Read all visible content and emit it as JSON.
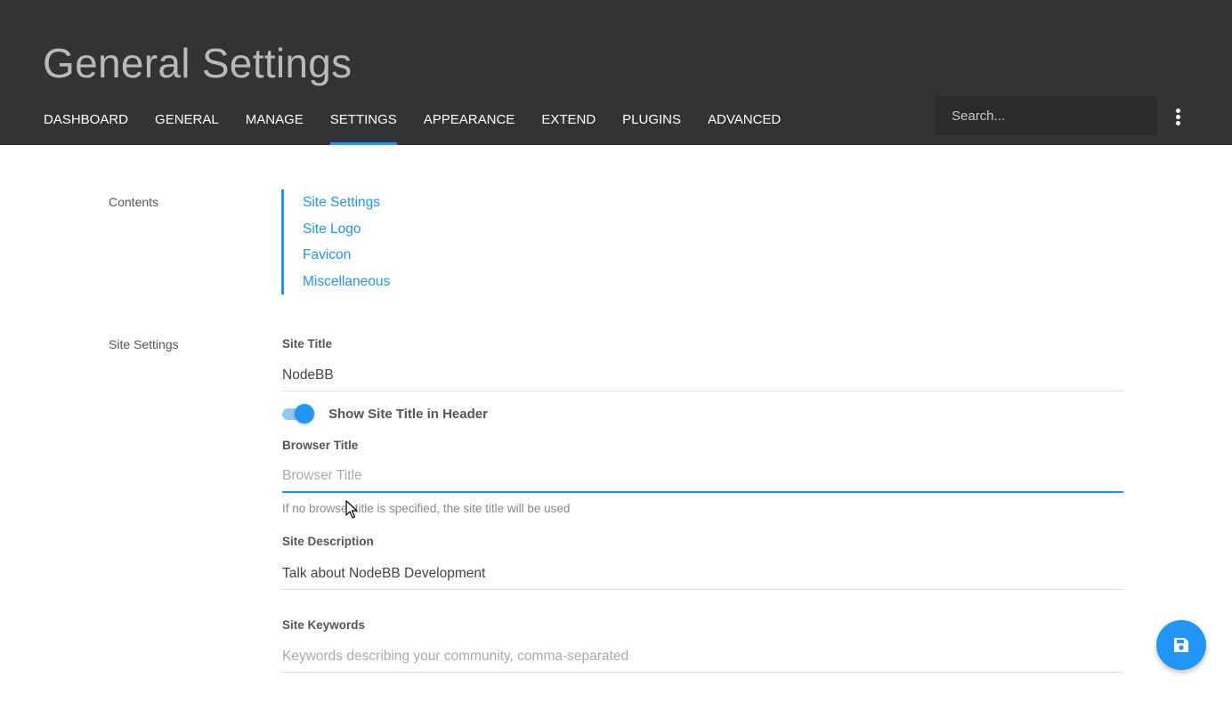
{
  "header": {
    "title": "General Settings",
    "nav": [
      {
        "label": "DASHBOARD",
        "active": false
      },
      {
        "label": "GENERAL",
        "active": false
      },
      {
        "label": "MANAGE",
        "active": false
      },
      {
        "label": "SETTINGS",
        "active": true
      },
      {
        "label": "APPEARANCE",
        "active": false
      },
      {
        "label": "EXTEND",
        "active": false
      },
      {
        "label": "PLUGINS",
        "active": false
      },
      {
        "label": "ADVANCED",
        "active": false
      }
    ],
    "search_placeholder": "Search...",
    "menu_icon": "more-vertical-icon"
  },
  "contents": {
    "label": "Contents",
    "links": [
      "Site Settings",
      "Site Logo",
      "Favicon",
      "Miscellaneous"
    ]
  },
  "site_settings": {
    "label": "Site Settings",
    "site_title": {
      "label": "Site Title",
      "value": "NodeBB"
    },
    "show_title_toggle": {
      "label": "Show Site Title in Header",
      "checked": true
    },
    "browser_title": {
      "label": "Browser Title",
      "value": "",
      "placeholder": "Browser Title",
      "help": "If no browser title is specified, the site title will be used"
    },
    "site_description": {
      "label": "Site Description",
      "value": "Talk about NodeBB Development"
    },
    "site_keywords": {
      "label": "Site Keywords",
      "value": "",
      "placeholder": "Keywords describing your community, comma-separated"
    }
  },
  "save_button": {
    "icon": "save-icon"
  },
  "colors": {
    "header_bg": "#333333",
    "accent": "#2196f3"
  }
}
